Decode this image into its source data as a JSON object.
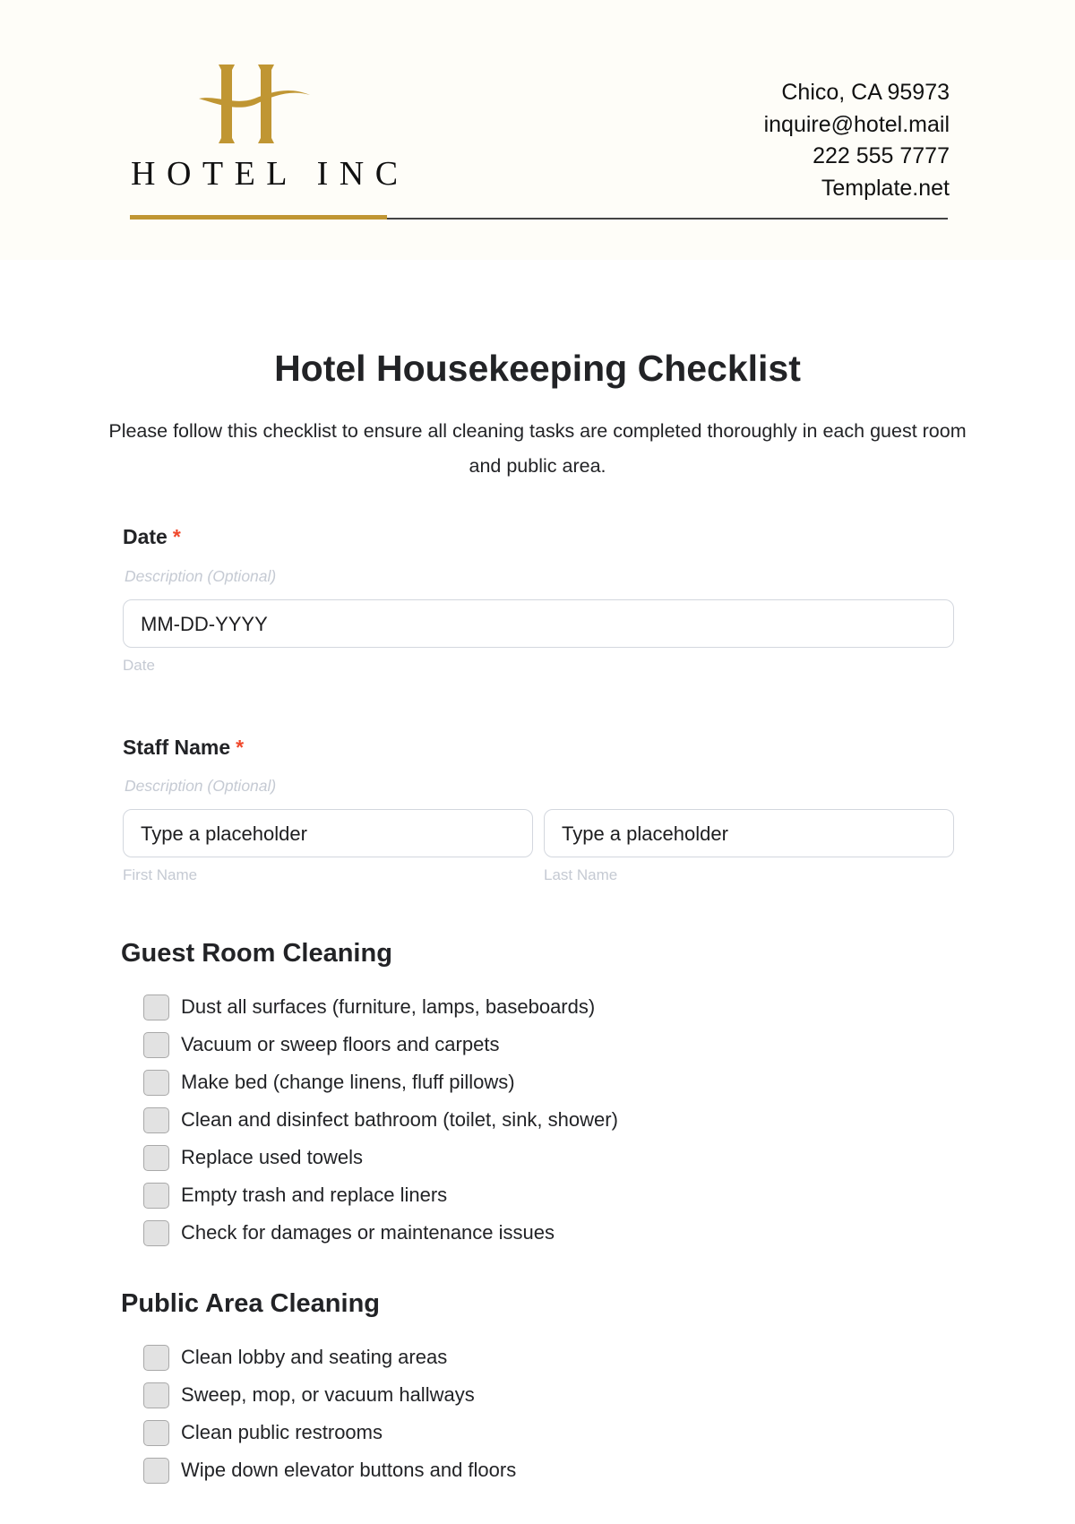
{
  "header": {
    "brand": "HOTEL INC",
    "brand_color": "#c09633",
    "contact": {
      "address": "Chico, CA 95973",
      "email": "inquire@hotel.mail",
      "phone": "222 555 7777",
      "website": "Template.net"
    }
  },
  "title": "Hotel Housekeeping Checklist",
  "intro": "Please follow this checklist to ensure all cleaning tasks are completed thoroughly in each guest room and public area.",
  "fields": {
    "date": {
      "label": "Date",
      "required_mark": "*",
      "description": "Description (Optional)",
      "value": "MM-DD-YYYY",
      "sub_label": "Date"
    },
    "staff_name": {
      "label": "Staff Name",
      "required_mark": "*",
      "description": "Description (Optional)",
      "first": {
        "value": "Type a placeholder",
        "sub_label": "First Name"
      },
      "last": {
        "value": "Type a placeholder",
        "sub_label": "Last Name"
      }
    }
  },
  "sections": [
    {
      "heading": "Guest Room Cleaning",
      "items": [
        {
          "label": "Dust all surfaces (furniture, lamps, baseboards)",
          "checked": false
        },
        {
          "label": "Vacuum or sweep floors and carpets",
          "checked": false
        },
        {
          "label": "Make bed (change linens, fluff pillows)",
          "checked": false
        },
        {
          "label": "Clean and disinfect bathroom (toilet, sink, shower)",
          "checked": false
        },
        {
          "label": "Replace used towels",
          "checked": false
        },
        {
          "label": "Empty trash and replace liners",
          "checked": false
        },
        {
          "label": "Check for damages or maintenance issues",
          "checked": false
        }
      ]
    },
    {
      "heading": "Public Area Cleaning",
      "items": [
        {
          "label": "Clean lobby and seating areas",
          "checked": false
        },
        {
          "label": "Sweep, mop, or vacuum hallways",
          "checked": false
        },
        {
          "label": "Clean public restrooms",
          "checked": false
        },
        {
          "label": "Wipe down elevator buttons and floors",
          "checked": false
        }
      ]
    }
  ]
}
